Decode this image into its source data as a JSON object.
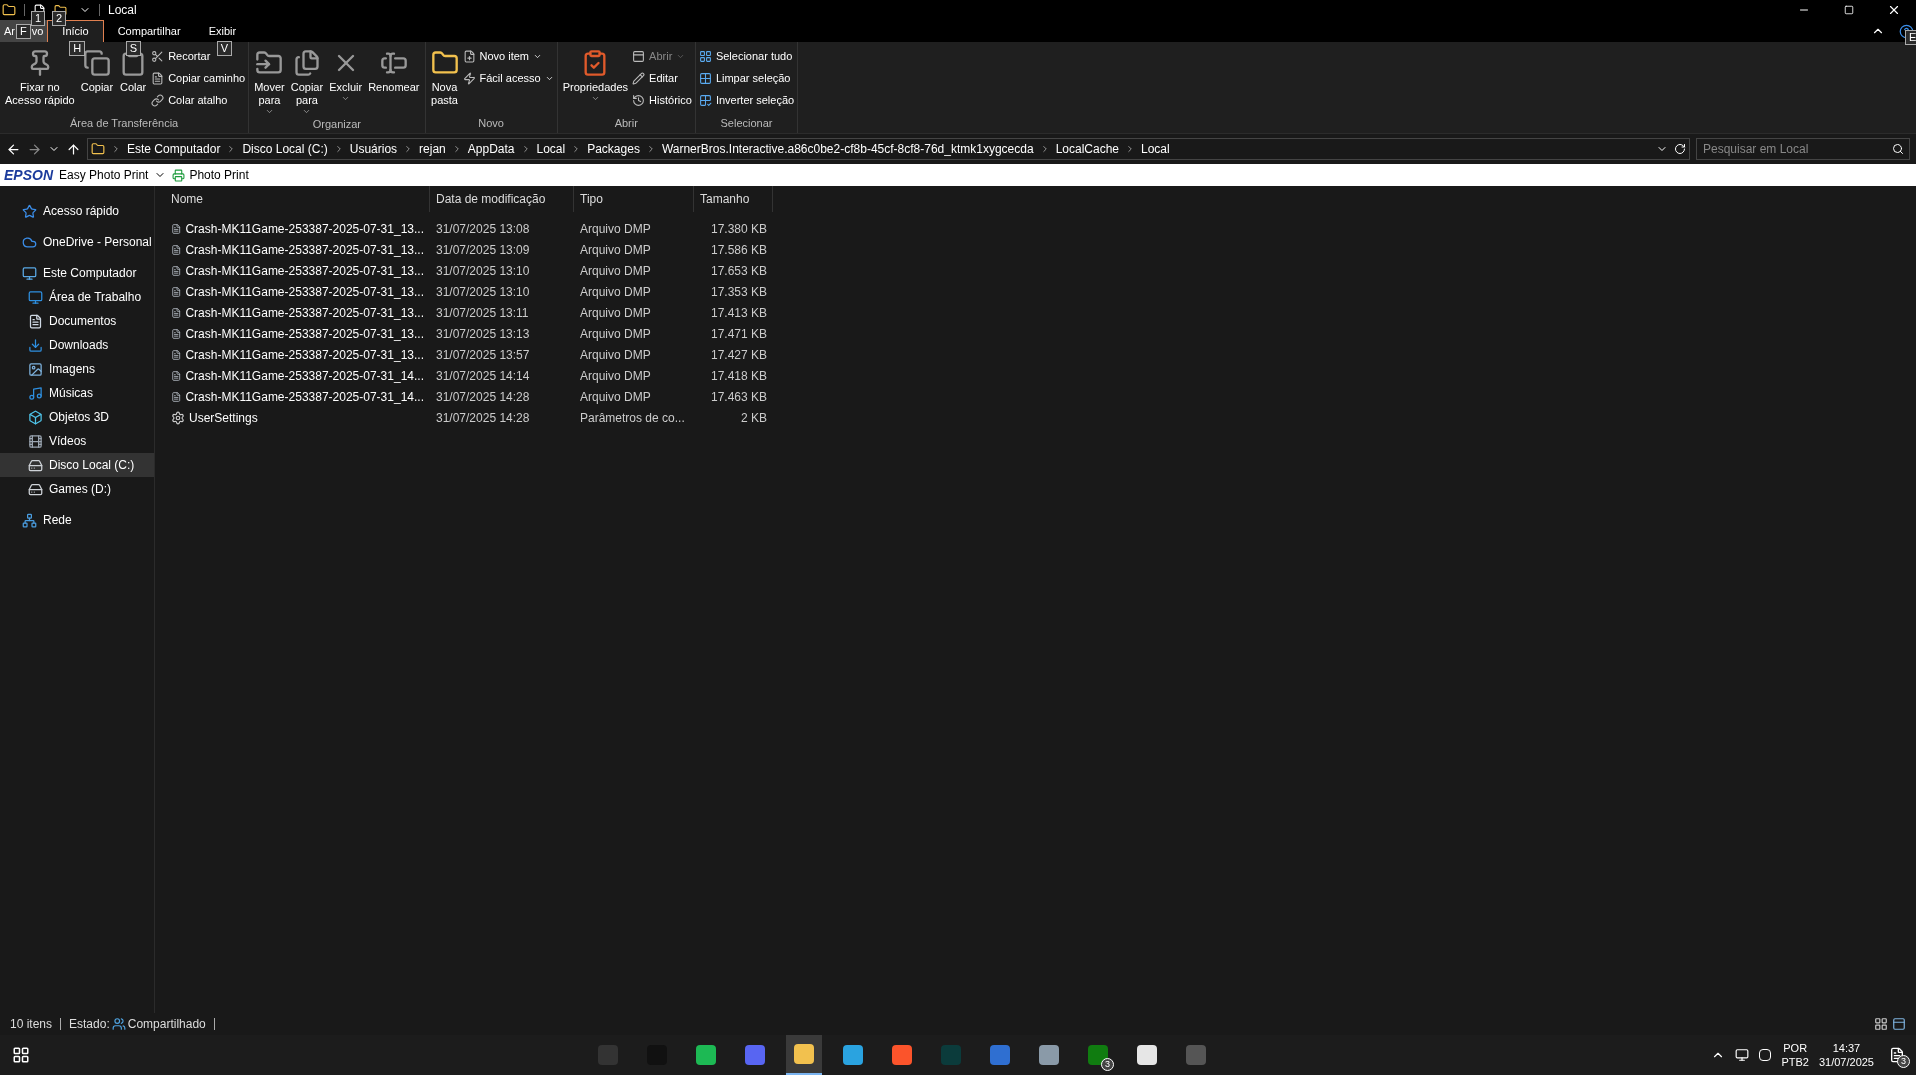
{
  "window": {
    "title": "Local"
  },
  "quick_access": [
    {
      "keytip": "1"
    },
    {
      "keytip": "2"
    }
  ],
  "file_tab": {
    "label_parts": [
      "Ar",
      "vo"
    ],
    "keytip": "F"
  },
  "tabs": [
    {
      "label": "Início",
      "selected": true,
      "keytip": "H"
    },
    {
      "label": "Compartilhar",
      "selected": false,
      "keytip": "S"
    },
    {
      "label": "Exibir",
      "selected": false,
      "keytip": "V"
    }
  ],
  "help_keytip": "E",
  "ribbon_groups": [
    {
      "label": "Área de Transferência",
      "large": [
        {
          "lines": [
            "Fixar no",
            "Acesso rápido"
          ],
          "menu": false
        },
        {
          "lines": [
            "Copiar"
          ],
          "menu": false
        },
        {
          "lines": [
            "Colar"
          ],
          "menu": false
        }
      ],
      "small": [
        {
          "label": "Recortar",
          "disabled": false,
          "menu": false
        },
        {
          "label": "Copiar caminho",
          "disabled": false,
          "menu": false
        },
        {
          "label": "Colar atalho",
          "disabled": false,
          "menu": false
        }
      ]
    },
    {
      "label": "Organizar",
      "large": [
        {
          "lines": [
            "Mover",
            "para"
          ],
          "menu": true
        },
        {
          "lines": [
            "Copiar",
            "para"
          ],
          "menu": true
        },
        {
          "lines": [
            "Excluir"
          ],
          "menu": true
        },
        {
          "lines": [
            "Renomear"
          ],
          "menu": false
        }
      ]
    },
    {
      "label": "Novo",
      "large": [
        {
          "lines": [
            "Nova",
            "pasta"
          ],
          "menu": false
        }
      ],
      "small": [
        {
          "label": "Novo item",
          "disabled": false,
          "menu": true
        },
        {
          "label": "Fácil acesso",
          "disabled": false,
          "menu": true
        }
      ]
    },
    {
      "label": "Abrir",
      "large": [
        {
          "lines": [
            "Propriedades"
          ],
          "menu": true
        }
      ],
      "small": [
        {
          "label": "Abrir",
          "disabled": true,
          "menu": true
        },
        {
          "label": "Editar",
          "disabled": false,
          "menu": false
        },
        {
          "label": "Histórico",
          "disabled": false,
          "menu": false
        }
      ]
    },
    {
      "label": "Selecionar",
      "small": [
        {
          "label": "Selecionar tudo",
          "disabled": false,
          "menu": false
        },
        {
          "label": "Limpar seleção",
          "disabled": false,
          "menu": false
        },
        {
          "label": "Inverter seleção",
          "disabled": false,
          "menu": false
        }
      ]
    }
  ],
  "address_bar": {
    "path": [
      "Este Computador",
      "Disco Local (C:)",
      "Usuários",
      "rejan",
      "AppData",
      "Local",
      "Packages",
      "WarnerBros.Interactive.a86c0be2-cf8b-45cf-8cf8-76d_ktmk1xygcecda",
      "LocalCache",
      "Local"
    ]
  },
  "search": {
    "placeholder": "Pesquisar em Local"
  },
  "epson_bar": {
    "brand": "EPSON",
    "app": "Easy Photo Print",
    "button": "Photo Print"
  },
  "sidebar": {
    "items": [
      {
        "label": "Acesso rápido",
        "selected": false
      },
      {
        "label": "OneDrive - Personal",
        "selected": false
      },
      {
        "label": "Este Computador",
        "selected": false,
        "children": [
          {
            "label": "Área de Trabalho",
            "selected": false
          },
          {
            "label": "Documentos",
            "selected": false
          },
          {
            "label": "Downloads",
            "selected": false
          },
          {
            "label": "Imagens",
            "selected": false
          },
          {
            "label": "Músicas",
            "selected": false
          },
          {
            "label": "Objetos 3D",
            "selected": false
          },
          {
            "label": "Vídeos",
            "selected": false
          },
          {
            "label": "Disco Local (C:)",
            "selected": true
          },
          {
            "label": "Games (D:)",
            "selected": false
          }
        ]
      },
      {
        "label": "Rede",
        "selected": false
      }
    ]
  },
  "table": {
    "columns": [
      "Nome",
      "Data de modificação",
      "Tipo",
      "Tamanho"
    ],
    "rows": [
      {
        "kind": "dump",
        "name": "Crash-MK11Game-253387-2025-07-31_13...",
        "date": "31/07/2025 13:08",
        "type": "Arquivo DMP",
        "size": "17.380 KB"
      },
      {
        "kind": "dump",
        "name": "Crash-MK11Game-253387-2025-07-31_13...",
        "date": "31/07/2025 13:09",
        "type": "Arquivo DMP",
        "size": "17.586 KB"
      },
      {
        "kind": "dump",
        "name": "Crash-MK11Game-253387-2025-07-31_13...",
        "date": "31/07/2025 13:10",
        "type": "Arquivo DMP",
        "size": "17.653 KB"
      },
      {
        "kind": "dump",
        "name": "Crash-MK11Game-253387-2025-07-31_13...",
        "date": "31/07/2025 13:10",
        "type": "Arquivo DMP",
        "size": "17.353 KB"
      },
      {
        "kind": "dump",
        "name": "Crash-MK11Game-253387-2025-07-31_13...",
        "date": "31/07/2025 13:11",
        "type": "Arquivo DMP",
        "size": "17.413 KB"
      },
      {
        "kind": "dump",
        "name": "Crash-MK11Game-253387-2025-07-31_13...",
        "date": "31/07/2025 13:13",
        "type": "Arquivo DMP",
        "size": "17.471 KB"
      },
      {
        "kind": "dump",
        "name": "Crash-MK11Game-253387-2025-07-31_13...",
        "date": "31/07/2025 13:57",
        "type": "Arquivo DMP",
        "size": "17.427 KB"
      },
      {
        "kind": "dump",
        "name": "Crash-MK11Game-253387-2025-07-31_14...",
        "date": "31/07/2025 14:14",
        "type": "Arquivo DMP",
        "size": "17.418 KB"
      },
      {
        "kind": "dump",
        "name": "Crash-MK11Game-253387-2025-07-31_14...",
        "date": "31/07/2025 14:28",
        "type": "Arquivo DMP",
        "size": "17.463 KB"
      },
      {
        "kind": "settings",
        "name": "UserSettings",
        "date": "31/07/2025 14:28",
        "type": "Parâmetros de co...",
        "size": "2 KB"
      }
    ]
  },
  "status_bar": {
    "count": "10 itens",
    "state_label": "Estado:",
    "state": "Compartilhado"
  },
  "taskbar": {
    "apps": [
      {
        "active": false
      },
      {
        "active": false
      },
      {
        "active": false
      },
      {
        "active": false
      },
      {
        "active": true
      },
      {
        "active": false
      },
      {
        "active": false
      },
      {
        "active": false
      },
      {
        "active": false
      },
      {
        "active": false
      },
      {
        "active": false,
        "badge": "3"
      },
      {
        "active": false
      },
      {
        "active": false
      }
    ],
    "language": "POR",
    "layout": "PTB2",
    "time": "14:37",
    "date": "31/07/2025",
    "notification_badge": "3"
  }
}
